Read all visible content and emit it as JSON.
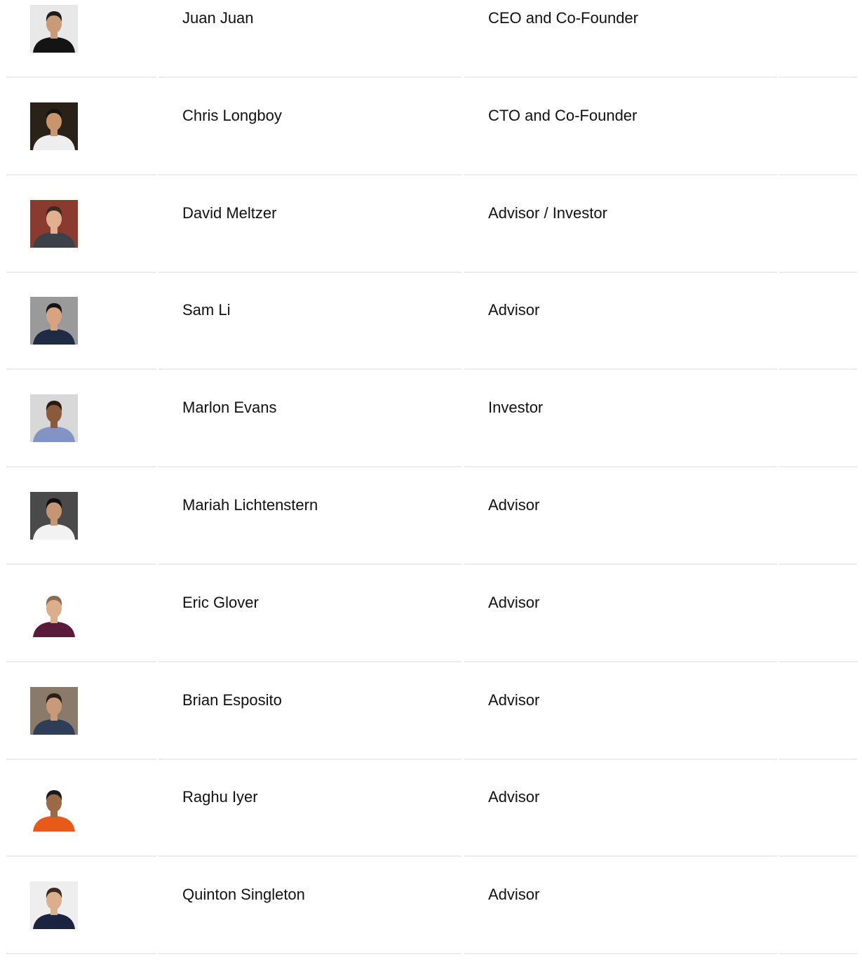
{
  "team": {
    "members": [
      {
        "name": "Juan Juan",
        "role": "CEO and Co-Founder",
        "photo_icon": "portrait-photo-icon",
        "bg": "#e8e8e8",
        "skin": "#c99a78",
        "hair": "#1c1c1c",
        "shirt": "#141414"
      },
      {
        "name": "Chris Longboy",
        "role": "CTO and Co-Founder",
        "photo_icon": "portrait-photo-icon",
        "bg": "#2a2218",
        "skin": "#c8956c",
        "hair": "#141414",
        "shirt": "#eeeeee"
      },
      {
        "name": "David Meltzer",
        "role": "Advisor / Investor",
        "photo_icon": "portrait-photo-icon",
        "bg": "#8a3a2e",
        "skin": "#e0b090",
        "hair": "#3a2a20",
        "shirt": "#3c4048"
      },
      {
        "name": "Sam Li",
        "role": "Advisor",
        "photo_icon": "portrait-photo-icon",
        "bg": "#9a9a9a",
        "skin": "#d6a47e",
        "hair": "#151515",
        "shirt": "#1f2a44"
      },
      {
        "name": "Marlon Evans",
        "role": "Investor",
        "photo_icon": "portrait-photo-icon",
        "bg": "#d8d8d8",
        "skin": "#8a5a3c",
        "hair": "#2a1a12",
        "shirt": "#8294c4"
      },
      {
        "name": "Mariah Lichtenstern",
        "role": "Advisor",
        "photo_icon": "portrait-photo-icon",
        "bg": "#4a4a4a",
        "skin": "#c69674",
        "hair": "#0f0f0f",
        "shirt": "#f2f2f2"
      },
      {
        "name": "Eric Glover",
        "role": "Advisor",
        "photo_icon": "portrait-photo-icon",
        "bg": "#ffffff",
        "skin": "#dcae8c",
        "hair": "#8a6a50",
        "shirt": "#5a1a3a"
      },
      {
        "name": "Brian Esposito",
        "role": "Advisor",
        "photo_icon": "portrait-photo-icon",
        "bg": "#8a7a6a",
        "skin": "#c89a78",
        "hair": "#2a2018",
        "shirt": "#2e3e56"
      },
      {
        "name": "Raghu Iyer",
        "role": "Advisor",
        "photo_icon": "portrait-photo-icon",
        "bg": "#ffffff",
        "skin": "#9a6a48",
        "hair": "#1a1a1a",
        "shirt": "#e85a1a"
      },
      {
        "name": "Quinton Singleton",
        "role": "Advisor",
        "photo_icon": "portrait-photo-icon",
        "bg": "#eeeeee",
        "skin": "#dcae90",
        "hair": "#3a2a22",
        "shirt": "#1a2440"
      }
    ]
  }
}
